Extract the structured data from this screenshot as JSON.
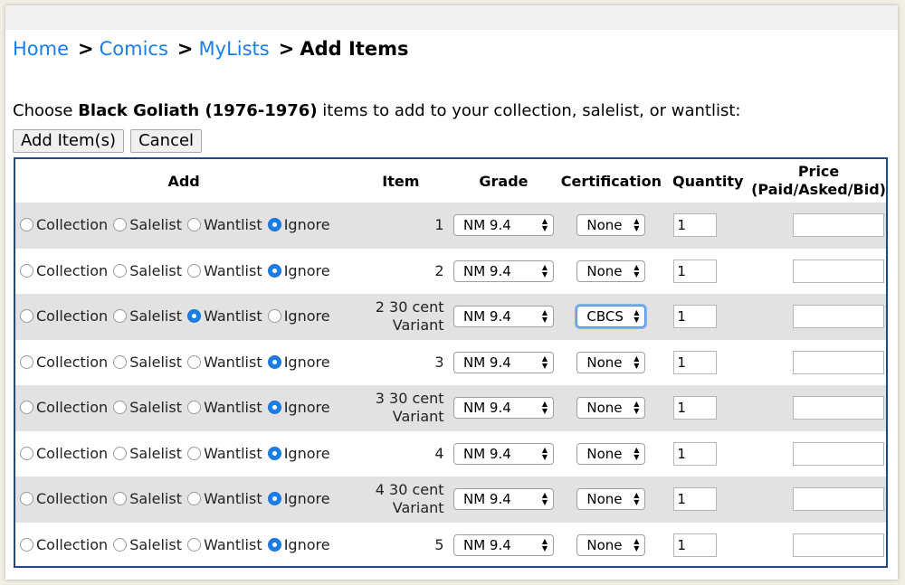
{
  "breadcrumb": {
    "home": "Home",
    "comics": "Comics",
    "mylists": "MyLists",
    "current": "Add Items",
    "separator": ">"
  },
  "intro": {
    "prefix": "Choose ",
    "series": "Black Goliath (1976-1976)",
    "suffix": " items to add to your collection, salelist, or wantlist:"
  },
  "buttons": {
    "add": "Add Item(s)",
    "cancel": "Cancel"
  },
  "table": {
    "headers": {
      "add": "Add",
      "item": "Item",
      "grade": "Grade",
      "certification": "Certification",
      "quantity": "Quantity",
      "price_line1": "Price",
      "price_line2": "(Paid/Asked/Bid)"
    },
    "option_labels": [
      "Collection",
      "Salelist",
      "Wantlist",
      "Ignore"
    ],
    "rows": [
      {
        "item_line1": "1",
        "item_line2": "",
        "grade": "NM 9.4",
        "cert": "None",
        "qty": "1",
        "price": "",
        "selected": "Ignore"
      },
      {
        "item_line1": "2",
        "item_line2": "",
        "grade": "NM 9.4",
        "cert": "None",
        "qty": "1",
        "price": "",
        "selected": "Ignore"
      },
      {
        "item_line1": "2 30 cent",
        "item_line2": "Variant",
        "grade": "NM 9.4",
        "cert": "CBCS",
        "qty": "1",
        "price": "",
        "selected": "Wantlist"
      },
      {
        "item_line1": "3",
        "item_line2": "",
        "grade": "NM 9.4",
        "cert": "None",
        "qty": "1",
        "price": "",
        "selected": "Ignore"
      },
      {
        "item_line1": "3 30 cent",
        "item_line2": "Variant",
        "grade": "NM 9.4",
        "cert": "None",
        "qty": "1",
        "price": "",
        "selected": "Ignore"
      },
      {
        "item_line1": "4",
        "item_line2": "",
        "grade": "NM 9.4",
        "cert": "None",
        "qty": "1",
        "price": "",
        "selected": "Ignore"
      },
      {
        "item_line1": "4 30 cent",
        "item_line2": "Variant",
        "grade": "NM 9.4",
        "cert": "None",
        "qty": "1",
        "price": "",
        "selected": "Ignore"
      },
      {
        "item_line1": "5",
        "item_line2": "",
        "grade": "NM 9.4",
        "cert": "None",
        "qty": "1",
        "price": "",
        "selected": "Ignore"
      }
    ]
  },
  "colors": {
    "link": "#1a7ee6",
    "radio_selected": "#1a7ee6",
    "table_border": "#1b4a8a",
    "row_alt": "#e2e2e2"
  }
}
